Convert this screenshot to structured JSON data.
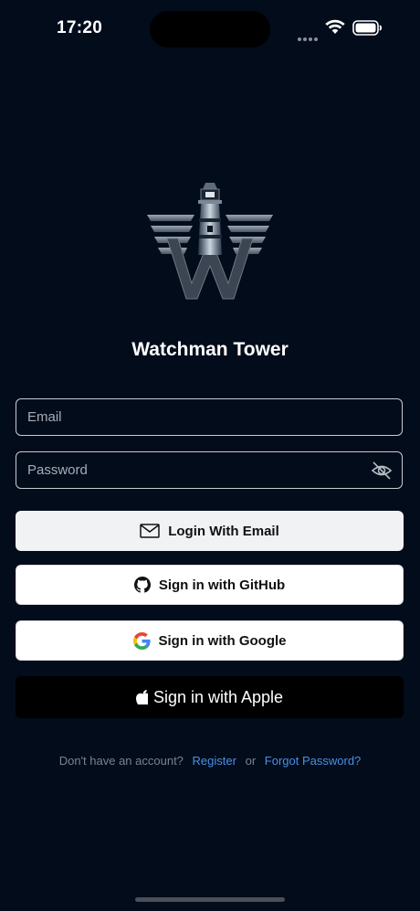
{
  "status": {
    "time": "17:20"
  },
  "app": {
    "title": "Watchman Tower"
  },
  "form": {
    "email_placeholder": "Email",
    "password_placeholder": "Password"
  },
  "buttons": {
    "email": "Login With Email",
    "github": "Sign in with GitHub",
    "google": "Sign in with Google",
    "apple": "Sign in with Apple"
  },
  "footer": {
    "prompt": "Don't have an account?",
    "register": "Register",
    "or": "or",
    "forgot": "Forgot Password?"
  },
  "icons": [
    "wifi-icon",
    "battery-icon",
    "watchman-tower-logo",
    "eye-off-icon",
    "mail-icon",
    "github-icon",
    "google-icon",
    "apple-icon"
  ],
  "colors": {
    "background": "#020c1b",
    "link": "#4a90e2",
    "apple_button": "#000000"
  }
}
